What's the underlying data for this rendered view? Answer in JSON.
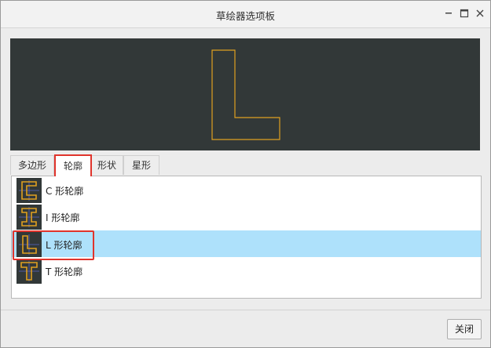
{
  "window": {
    "title": "草绘器选项板",
    "controls": {
      "minimize_icon": "minimize-icon",
      "maximize_icon": "maximize-icon",
      "close_icon": "close-icon"
    }
  },
  "preview": {
    "shape": "L",
    "background_color": "#323838",
    "stroke_color": "#e0a020"
  },
  "tabs": [
    {
      "label": "多边形",
      "selected": false
    },
    {
      "label": "轮廓",
      "selected": true
    },
    {
      "label": "形状",
      "selected": false
    },
    {
      "label": "星形",
      "selected": false
    }
  ],
  "list": {
    "items": [
      {
        "label": "C 形轮廓",
        "icon": "c-profile-icon",
        "selected": false
      },
      {
        "label": "I 形轮廓",
        "icon": "i-profile-icon",
        "selected": false
      },
      {
        "label": "L 形轮廓",
        "icon": "l-profile-icon",
        "selected": true
      },
      {
        "label": "T 形轮廓",
        "icon": "t-profile-icon",
        "selected": false
      }
    ],
    "selected_color": "#aee1fb"
  },
  "footer": {
    "close_label": "关闭"
  },
  "annotation_color": "#e0342c"
}
